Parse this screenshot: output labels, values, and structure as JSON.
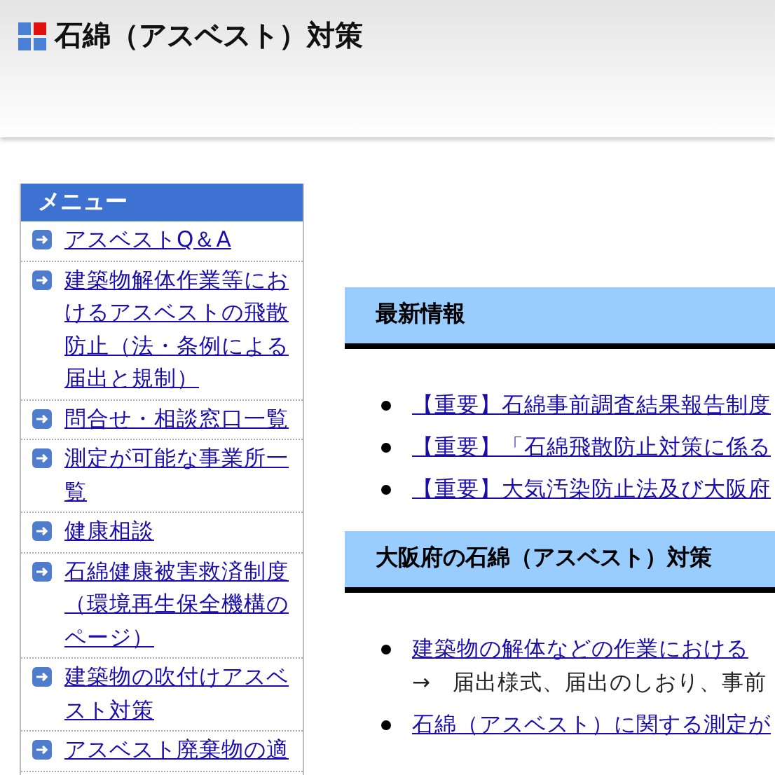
{
  "header": {
    "title": "石綿（アスベスト）対策"
  },
  "menu": {
    "title": "メニュー",
    "items": [
      {
        "label": "アスベストQ＆A"
      },
      {
        "label": "建築物解体作業等におけるアスベストの飛散防止（法・条例による届出と規制）"
      },
      {
        "label": "問合せ・相談窓口一覧"
      },
      {
        "label": "測定が可能な事業所一覧"
      },
      {
        "label": "健康相談"
      },
      {
        "label": "石綿健康被害救済制度（環境再生保全機構のページ）"
      },
      {
        "label": "建築物の吹付けアスベスト対策"
      },
      {
        "label": "アスベスト廃棄物の適"
      }
    ]
  },
  "sections": [
    {
      "heading": "最新情報",
      "items": [
        {
          "link": "【重要】石綿事前調査結果報告制度"
        },
        {
          "link": "【重要】「石綿飛散防止対策に係る"
        },
        {
          "link": "【重要】大気汚染防止法及び大阪府"
        }
      ]
    },
    {
      "heading": "大阪府の石綿（アスベスト）対策",
      "items": [
        {
          "link": "建築物の解体などの作業における",
          "note": "→　届出様式、届出のしおり、事前"
        },
        {
          "link": "石綿（アスベスト）に関する測定が"
        }
      ]
    }
  ]
}
